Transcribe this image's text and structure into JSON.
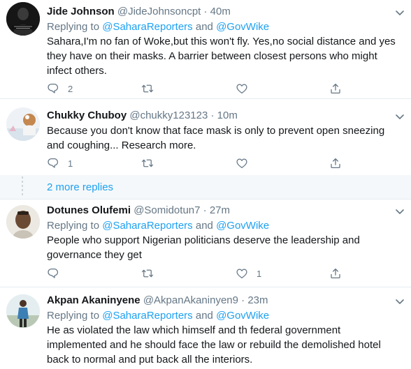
{
  "tweets": [
    {
      "name": "Jide Johnson",
      "handle": "@JideJohnsoncpt",
      "time": "40m",
      "replying_prefix": "Replying to",
      "mention1": "@SaharaReporters",
      "and": "and",
      "mention2": "@GovWike",
      "text": "Sahara,I'm no fan of Woke,but this won't fly. Yes,no social distance and yes they have on their masks. A barrier between closest persons who might infect others.",
      "reply_count": "2",
      "like_count": ""
    },
    {
      "name": "Chukky Chuboy",
      "handle": "@chukky123123",
      "time": "10m",
      "text": "Because you don't know that face mask is only to prevent open sneezing and coughing... Research more.",
      "reply_count": "1",
      "like_count": ""
    },
    {
      "name": "Dotunes Olufemi",
      "handle": "@Somidotun7",
      "time": "27m",
      "replying_prefix": "Replying to",
      "mention1": "@SaharaReporters",
      "and": "and",
      "mention2": "@GovWike",
      "text": "People who support Nigerian politicians deserve the leadership and governance they get",
      "reply_count": "",
      "like_count": "1"
    },
    {
      "name": "Akpan Akaninyene",
      "handle": "@AkpanAkaninyen9",
      "time": "23m",
      "replying_prefix": "Replying to",
      "mention1": "@SaharaReporters",
      "and": "and",
      "mention2": "@GovWike",
      "text": "He as violated the law which himself and th federal government implemented and he should face the law or rebuild the demolished hotel back to normal and put back all the interiors."
    }
  ],
  "more_replies": "2 more replies",
  "separator": "·",
  "avatar1_caption": "I DON'T NEED A REASON, I JUST DO",
  "colors": {
    "accent": "#1da1f2",
    "muted": "#657786",
    "text": "#14171a",
    "border": "#e6ecf0"
  },
  "icons": [
    "reply-icon",
    "retweet-icon",
    "like-icon",
    "share-icon",
    "chevron-down-icon"
  ]
}
